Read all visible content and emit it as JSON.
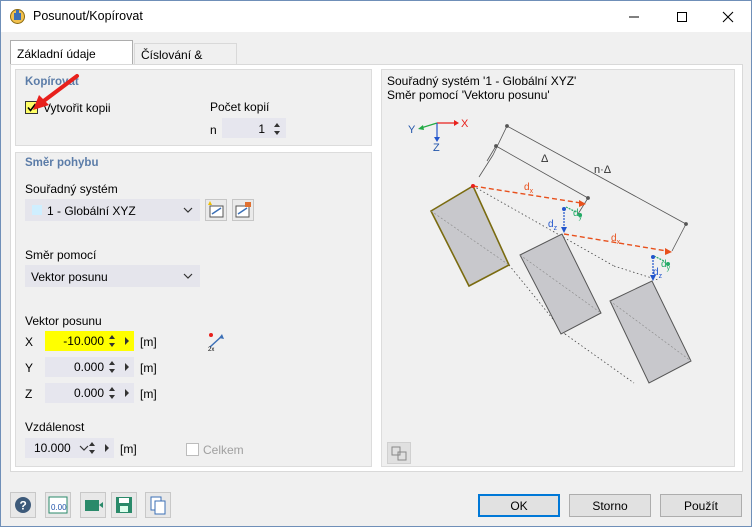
{
  "window": {
    "title": "Posunout/Kopírovat"
  },
  "tabs": [
    {
      "label": "Základní údaje"
    },
    {
      "label": "Číslování & možnosti"
    }
  ],
  "copy_group": {
    "title": "Kopírovat",
    "create_copy_label": "Vytvořit kopii",
    "create_copy_checked": true,
    "count_label": "Počet kopií",
    "count_prefix": "n",
    "count_value": "1"
  },
  "direction_group": {
    "title": "Směr pohybu",
    "coord_system_label": "Souřadný systém",
    "coord_system_value": "1 - Globální XYZ",
    "direction_by_label": "Směr pomocí",
    "direction_by_value": "Vektor posunu",
    "vector_label": "Vektor posunu",
    "vector": [
      {
        "axis": "X",
        "value": "-10.000",
        "unit": "[m]"
      },
      {
        "axis": "Y",
        "value": "0.000",
        "unit": "[m]"
      },
      {
        "axis": "Z",
        "value": "0.000",
        "unit": "[m]"
      }
    ],
    "distance_label": "Vzdálenost",
    "distance_value": "10.000",
    "distance_unit": "[m]",
    "total_label": "Celkem"
  },
  "preview": {
    "line1": "Souřadný systém '1 - Globální XYZ'",
    "line2": "Směr pomocí 'Vektoru posunu'",
    "axis_x": "X",
    "axis_y": "Y",
    "axis_z": "Z",
    "delta": "Δ",
    "n_delta": "n·Δ",
    "dx": "d",
    "dx_sub": "x",
    "dy_sub": "y",
    "dz_sub": "z"
  },
  "buttons": {
    "ok": "OK",
    "cancel": "Storno",
    "apply": "Použít"
  },
  "colors": {
    "accent": "#0078d7",
    "highlight_field": "#ffff00",
    "group_title": "#5b7ca8",
    "arrow_red": "#e8201c"
  }
}
